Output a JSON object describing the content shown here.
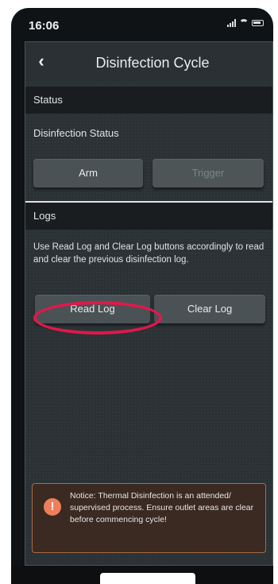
{
  "status_bar": {
    "time": "16:06",
    "icons": [
      "signal-icon",
      "wifi-icon",
      "battery-icon"
    ]
  },
  "nav": {
    "back_icon": "‹",
    "title": "Disinfection Cycle"
  },
  "status_section": {
    "header": "Status",
    "label": "Disinfection Status",
    "arm_label": "Arm",
    "trigger_label": "Trigger"
  },
  "logs_section": {
    "header": "Logs",
    "description": "Use Read Log and Clear Log buttons accordingly to read and clear the previous disinfection log.",
    "read_label": "Read Log",
    "clear_label": "Clear Log"
  },
  "notice": {
    "icon": "!",
    "text": "Notice: Thermal Disinfection is an attended/ supervised process. Ensure outlet areas are clear before commencing cycle!"
  },
  "colors": {
    "annotation": "#e0184a",
    "notice_border": "#a96a46",
    "notice_icon": "#ee7e5c"
  }
}
